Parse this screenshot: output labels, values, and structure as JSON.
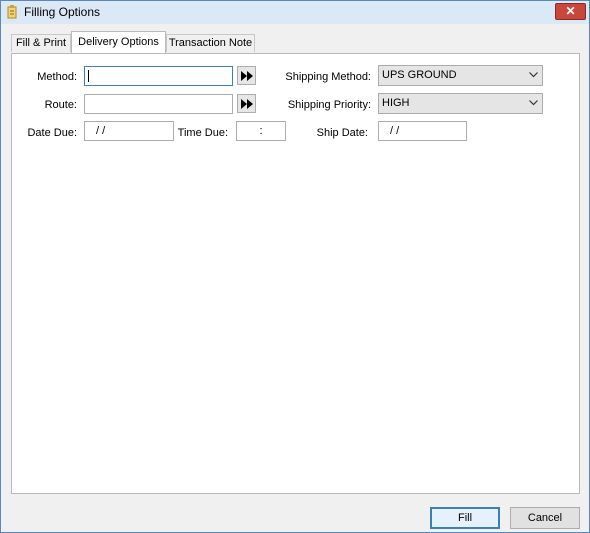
{
  "window": {
    "title": "Filling Options",
    "close_glyph": "✕"
  },
  "tabs": [
    {
      "label": "Fill & Print",
      "active": false
    },
    {
      "label": "Delivery Options",
      "active": true
    },
    {
      "label": "Transaction Note",
      "active": false
    }
  ],
  "form": {
    "method": {
      "label": "Method:",
      "value": ""
    },
    "route": {
      "label": "Route:",
      "value": ""
    },
    "date_due": {
      "label": "Date Due:",
      "value": " / /"
    },
    "time_due": {
      "label": "Time Due:",
      "value": ":"
    },
    "shipping_method": {
      "label": "Shipping Method:",
      "selected": "UPS GROUND"
    },
    "shipping_priority": {
      "label": "Shipping Priority:",
      "selected": "HIGH"
    },
    "ship_date": {
      "label": "Ship Date:",
      "value": " / /"
    }
  },
  "buttons": {
    "fill": "Fill",
    "cancel": "Cancel"
  },
  "icons": {
    "app": "document-pencil-icon",
    "lookup": "fast-forward-icon",
    "dropdown": "chevron-down-icon",
    "close": "close-icon"
  },
  "colors": {
    "titlebar": "#dbe8f5",
    "close": "#c9463d",
    "focus": "#3c7fb1"
  }
}
